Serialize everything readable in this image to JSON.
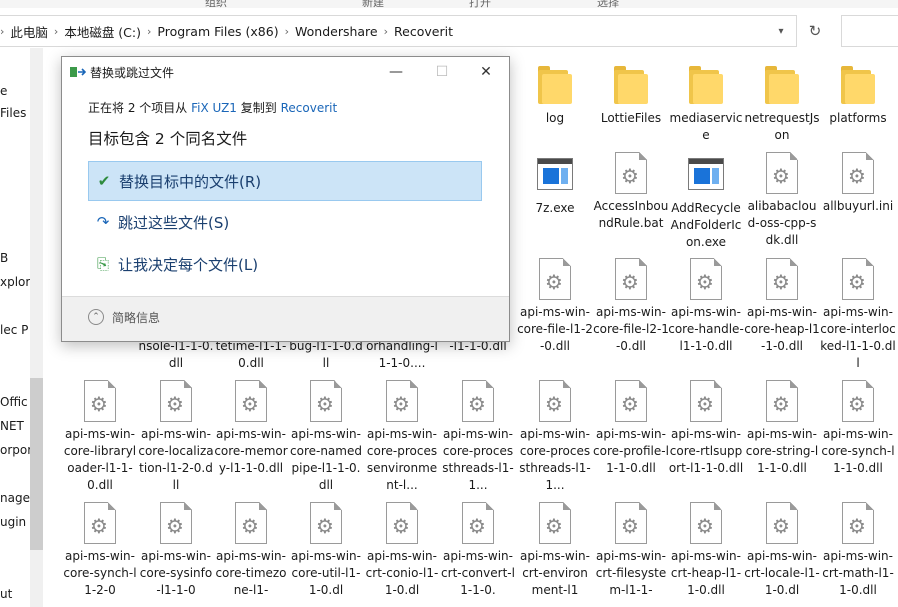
{
  "ribbon": [
    "组织",
    "新建",
    "打开",
    "选择"
  ],
  "breadcrumb": [
    "此电脑",
    "本地磁盘 (C:)",
    "Program Files (x86)",
    "Wondershare",
    "Recoverit"
  ],
  "nav": [
    "e",
    "Files",
    "B",
    "xplor",
    "lec P",
    "Offic",
    "NET",
    "orpor",
    "nage",
    "ugin",
    "ut"
  ],
  "dialog": {
    "title": "替换或跳过文件",
    "line_prefix": "正在将 2 个项目从",
    "source": "FiX UZ1",
    "line_mid": "复制到",
    "dest": "Recoverit",
    "heading": "目标包含 2 个同名文件",
    "options": [
      "替换目标中的文件(R)",
      "跳过这些文件(S)",
      "让我决定每个文件(L)"
    ],
    "details": "简略信息"
  },
  "files": {
    "row1": [
      "log",
      "LottieFiles",
      "mediaservice",
      "netrequestJson",
      "platforms"
    ],
    "row2": [
      "7z.exe",
      "AccessInboundRule.bat",
      "AddRecycleAndFolderIcon.exe",
      "alibabacloud-oss-cpp-sdk.dll",
      "allbuyurl.ini"
    ],
    "row3_hidden": [
      "nsole-l1-1-0.dll",
      "tetime-l1-1-0.dll",
      "bug-l1-1-0.dll",
      "orhandling-l1-1-0....",
      "-l1-1-0.dll"
    ],
    "row3": [
      "api-ms-win-core-file-l1-2-0.dll",
      "api-ms-win-core-file-l2-1-0.dll",
      "api-ms-win-core-handle-l1-1-0.dll",
      "api-ms-win-core-heap-l1-1-0.dll",
      "api-ms-win-core-interlocked-l1-1-0.dll"
    ],
    "row4": [
      "api-ms-win-core-libraryloader-l1-1-0.dll",
      "api-ms-win-core-localization-l1-2-0.dll",
      "api-ms-win-core-memory-l1-1-0.dll",
      "api-ms-win-core-namedpipe-l1-1-0.dll",
      "api-ms-win-core-processenvironment-l...",
      "api-ms-win-core-processthreads-l1-1...",
      "api-ms-win-core-processthreads-l1-1...",
      "api-ms-win-core-profile-l1-1-0.dll",
      "api-ms-win-core-rtlsupport-l1-1-0.dll",
      "api-ms-win-core-string-l1-1-0.dll",
      "api-ms-win-core-synch-l1-1-0.dll"
    ],
    "row5": [
      "api-ms-win-core-synch-l1-2-0",
      "api-ms-win-core-sysinfo-l1-1-0",
      "api-ms-win-core-timezone-l1-",
      "api-ms-win-core-util-l1-1-0.dl",
      "api-ms-win-crt-conio-l1-1-0.dl",
      "api-ms-win-crt-convert-l1-1-0.",
      "api-ms-win-crt-environment-l1",
      "api-ms-win-crt-filesystem-l1-1-",
      "api-ms-win-crt-heap-l1-1-0.dll",
      "api-ms-win-crt-locale-l1-1-0.dl",
      "api-ms-win-crt-math-l1-1-0.dll"
    ]
  }
}
